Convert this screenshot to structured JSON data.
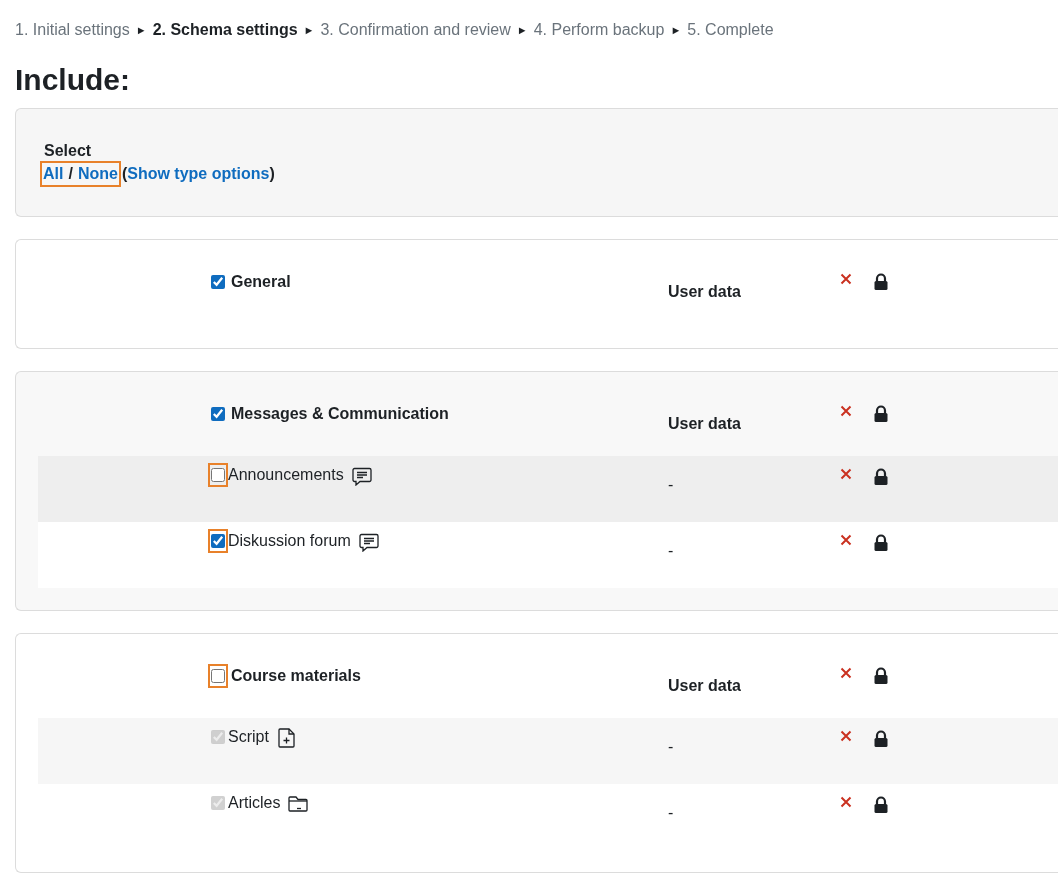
{
  "breadcrumb": [
    {
      "label": "1. Initial settings",
      "current": false
    },
    {
      "arrow": "►",
      "label": "2. Schema settings",
      "current": true
    },
    {
      "arrow": "►",
      "label": "3. Confirmation and review",
      "current": false
    },
    {
      "arrow": "►",
      "label": "4. Perform backup",
      "current": false
    },
    {
      "arrow": "►",
      "label": "5. Complete",
      "current": false
    }
  ],
  "heading": "Include:",
  "select": {
    "label": "Select",
    "all": "All",
    "separator": "/",
    "none": "None",
    "open": "(",
    "type_options": "Show type options",
    "close": ")",
    "highlighted": true
  },
  "sections": [
    {
      "title": "General",
      "checked": true,
      "highlighted": false,
      "user_data": "User data"
    },
    {
      "title": "Messages & Communication",
      "checked": true,
      "highlighted": false,
      "user_data": "User data",
      "activities": [
        {
          "name": "Announcements",
          "kind": "chat",
          "checked": false,
          "disabled": false,
          "highlighted": true,
          "user_data": "-"
        },
        {
          "name": "Diskussion forum",
          "kind": "chat",
          "checked": true,
          "disabled": false,
          "highlighted": true,
          "user_data": "-"
        }
      ]
    },
    {
      "title": "Course materials",
      "checked": false,
      "highlighted": true,
      "user_data": "User data",
      "activities": [
        {
          "name": "Script",
          "kind": "file",
          "checked": true,
          "disabled": true,
          "highlighted": false,
          "user_data": "-"
        },
        {
          "name": "Articles",
          "kind": "folder",
          "checked": true,
          "disabled": true,
          "highlighted": false,
          "user_data": "-"
        }
      ]
    }
  ]
}
